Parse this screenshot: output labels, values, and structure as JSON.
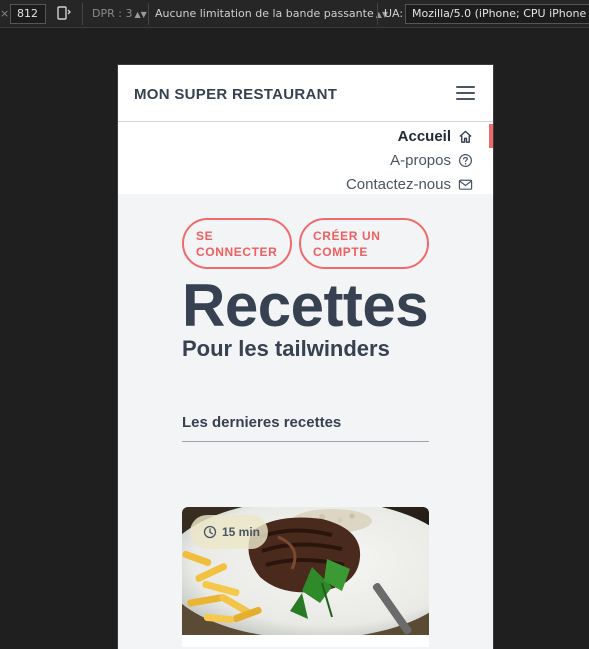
{
  "devtools": {
    "height_value": "812",
    "dpr_label": "DPR : 3",
    "throttling": "Aucune limitation de la bande passante",
    "ua_label": "UA:",
    "ua_value": "Mozilla/5.0 (iPhone; CPU iPhone O"
  },
  "header": {
    "brand": "MON SUPER RESTAURANT",
    "menu_icon": "hamburger-icon"
  },
  "nav": {
    "items": [
      {
        "label": "Accueil",
        "icon": "home-icon",
        "active": true
      },
      {
        "label": "A-propos",
        "icon": "question-circle-icon",
        "active": false
      },
      {
        "label": "Contactez-nous",
        "icon": "envelope-icon",
        "active": false
      }
    ]
  },
  "hero": {
    "login_button": "SE CONNECTER",
    "signup_button": "CRÉER UN COMPTE",
    "title": "Recettes",
    "subtitle": "Pour les tailwinders"
  },
  "recipes": {
    "section_title": "Les dernieres recettes",
    "cards": [
      {
        "duration": "15 min",
        "clock_icon": "clock-icon"
      }
    ]
  },
  "colors": {
    "accent": "#ef6b6b",
    "text": "#374151",
    "page_bg": "#f3f4f6"
  }
}
